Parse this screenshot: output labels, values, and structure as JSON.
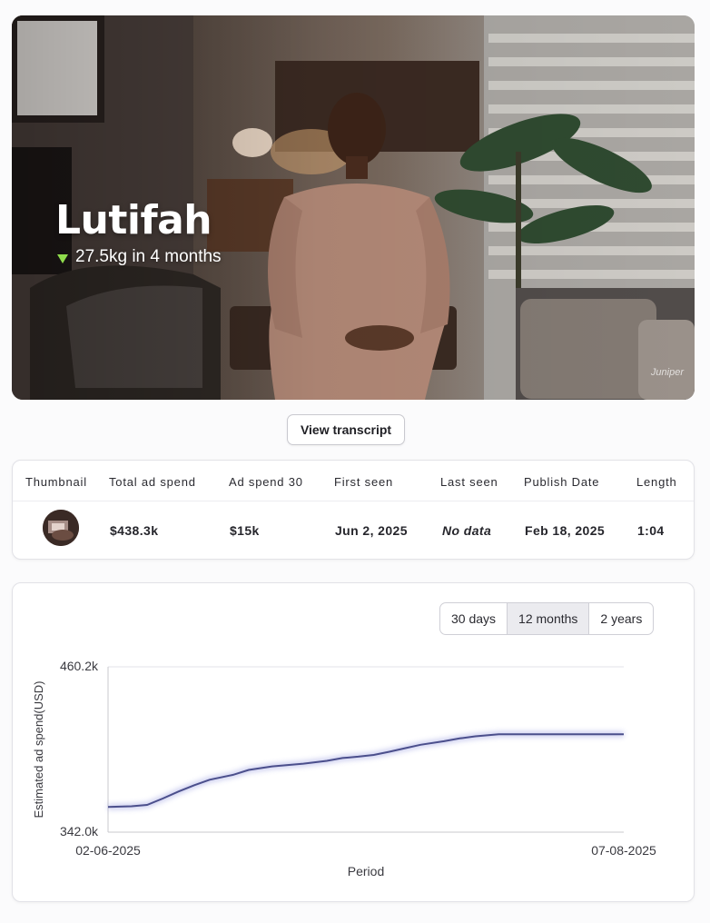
{
  "hero": {
    "name": "Lutifah",
    "subtitle": "27.5kg in 4 months",
    "watermark": "Juniper",
    "accent_color": "#8fdc4c",
    "indicator_icon": "triangle-down-icon"
  },
  "transcript_button": {
    "label": "View transcript"
  },
  "table": {
    "headers": [
      "Thumbnail",
      "Total ad spend",
      "Ad spend 30",
      "First seen",
      "Last seen",
      "Publish Date",
      "Length"
    ],
    "row": {
      "total_ad_spend": "$438.3k",
      "ad_spend_30": "$15k",
      "first_seen": "Jun 2, 2025",
      "last_seen": "No data",
      "publish_date": "Feb 18, 2025",
      "length": "1:04"
    }
  },
  "range_selector": {
    "options": [
      "30 days",
      "12 months",
      "2 years"
    ],
    "selected": "12 months"
  },
  "chart_data": {
    "type": "line",
    "xlabel": "Period",
    "ylabel": "Estimated ad spend(USD)",
    "ylim": [
      342.0,
      460.2
    ],
    "ytick_labels": [
      "460.2k",
      "342.0k"
    ],
    "x_start": "02-06-2025",
    "x_end": "07-08-2025",
    "x_ticks": [
      "02-06-2025",
      "07-08-2025"
    ],
    "series": [
      {
        "color": "#4b4f8c",
        "x": [
          "2025-06-02",
          "2025-06-05",
          "2025-06-07",
          "2025-06-09",
          "2025-06-11",
          "2025-06-13",
          "2025-06-15",
          "2025-06-18",
          "2025-06-20",
          "2025-06-23",
          "2025-06-25",
          "2025-06-27",
          "2025-06-30",
          "2025-07-02",
          "2025-07-04",
          "2025-07-06",
          "2025-07-08",
          "2025-07-10",
          "2025-07-12",
          "2025-07-15",
          "2025-07-17",
          "2025-07-19",
          "2025-07-22",
          "2025-07-24",
          "2025-07-26",
          "2025-07-28",
          "2025-07-31",
          "2025-08-02",
          "2025-08-04",
          "2025-08-07"
        ],
        "values": [
          360.0,
          360.5,
          361.5,
          366.0,
          371.0,
          375.5,
          379.5,
          383.0,
          386.5,
          389.0,
          390.0,
          391.0,
          393.0,
          395.0,
          396.0,
          397.2,
          399.5,
          402.0,
          404.5,
          407.0,
          409.0,
          410.5,
          412.0,
          412.0,
          412.0,
          412.0,
          412.0,
          412.0,
          412.0,
          412.0
        ]
      }
    ]
  }
}
